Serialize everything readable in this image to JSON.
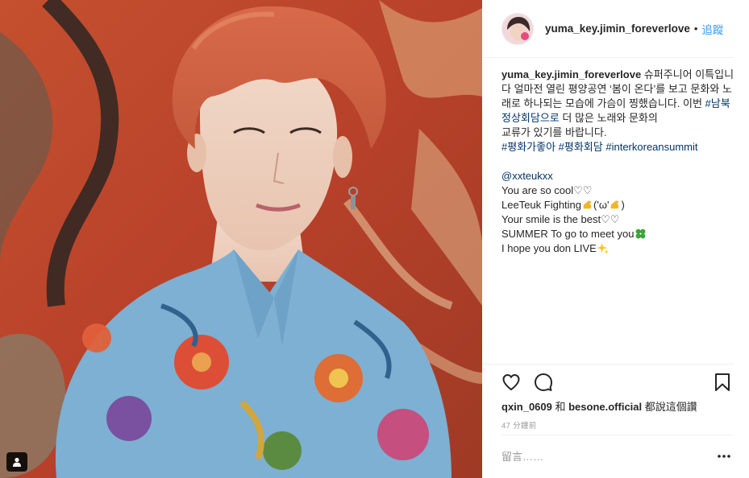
{
  "post": {
    "image_description": "",
    "username": "yuma_key.jimin_foreverlove",
    "dot": "•",
    "follow_label": "追蹤"
  },
  "caption": {
    "username": "yuma_key.jimin_foreverlove",
    "text_1": " 슈퍼주니어 이특입니다 얼마전 열린 평양공연 ‘봄이 온다’를 보고 문화와 노래로 하나되는 모습에 가슴이 찡했습니다. 이번 ",
    "hashtag_1": "#남북정상회담으로",
    "text_2": " 더 많은 노래와 문화의",
    "line_3": "교류가 있기를 바랍니다.",
    "hashtag_2": "#평화가좋아",
    "hashtag_3": "#평화회담",
    "hashtag_4": "#interkoreansummit"
  },
  "comment_lines": {
    "mention": "@xxteukxx",
    "line_1": "You are so cool♡♡",
    "line_2a": "LeeTeuk Fighting",
    "line_2b": "('ω'",
    "line_2c": ")",
    "line_3": "Your smile is the best♡♡",
    "line_4": "SUMMER To go to meet you",
    "line_5": "I hope you don LIVE"
  },
  "likes": {
    "user_1": "qxin_0609",
    "joiner": " 和 ",
    "user_2": "besone.official",
    "suffix": " 都說這個讚"
  },
  "timestamp": "47 分鐘前",
  "comment_input": {
    "placeholder": "留言……",
    "value": ""
  },
  "icons": {
    "like": "heart-outline-icon",
    "comment": "speech-bubble-icon",
    "save": "bookmark-icon",
    "more": "more-dots-icon",
    "tag": "user-tag-icon"
  },
  "colors": {
    "link_blue": "#3897f0",
    "hashtag": "#003569",
    "text": "#262626",
    "muted": "#999999",
    "divider": "#efefef"
  }
}
